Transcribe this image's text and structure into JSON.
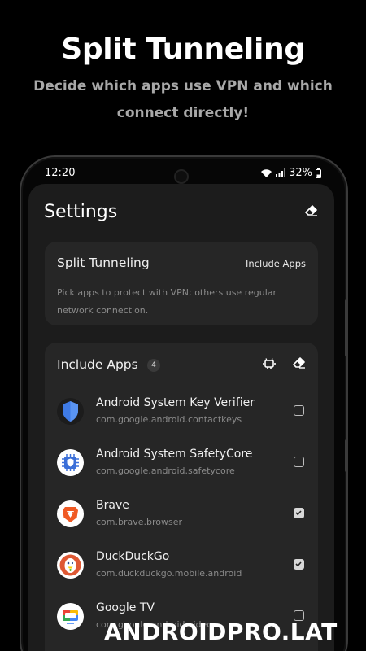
{
  "promo": {
    "title": "Split Tunneling",
    "subtitle": "Decide which apps use VPN and which connect directly!"
  },
  "status_bar": {
    "time": "12:20",
    "battery": "32%"
  },
  "settings": {
    "title": "Settings",
    "split_card": {
      "title": "Split Tunneling",
      "mode_value": "Include Apps",
      "description": "Pick apps to protect with VPN; others use regular network connection."
    },
    "apps_card": {
      "title": "Include Apps",
      "count": "4",
      "apps": [
        {
          "name": "Android System Key Verifier",
          "package": "com.google.android.contactkeys",
          "checked": false,
          "icon": "shield-icon"
        },
        {
          "name": "Android System SafetyCore",
          "package": "com.google.android.safetycore",
          "checked": false,
          "icon": "safetycore-icon"
        },
        {
          "name": "Brave",
          "package": "com.brave.browser",
          "checked": true,
          "icon": "brave-icon"
        },
        {
          "name": "DuckDuckGo",
          "package": "com.duckduckgo.mobile.android",
          "checked": true,
          "icon": "duckduckgo-icon"
        },
        {
          "name": "Google TV",
          "package": "com.google.android.videos",
          "checked": false,
          "icon": "google-tv-icon"
        }
      ]
    }
  },
  "watermark": "ANDROIDPRO.LAT",
  "colors": {
    "background": "#000000",
    "screen": "#1c1c1c",
    "card": "#262626",
    "muted": "#8a8a8a"
  }
}
